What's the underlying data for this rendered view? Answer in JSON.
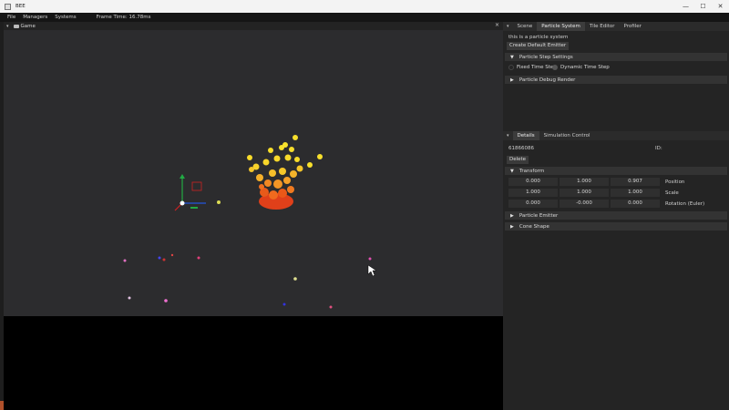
{
  "window": {
    "title": "BEE",
    "controls": [
      "—",
      "☐",
      "✕"
    ]
  },
  "menu": {
    "items": [
      "File",
      "Managers",
      "Systems"
    ],
    "frame_time": "Frame Time: 16.78ms"
  },
  "game_panel": {
    "tab_label": "Game",
    "close": "×"
  },
  "top_panel": {
    "tabs": [
      "Scene",
      "Particle System",
      "Tile Editor",
      "Profiler"
    ],
    "active_tab": "Particle System",
    "description": "this is a particle system",
    "create_button": "Create Default Emitter",
    "step_section": "Particle Step Settings",
    "fixed_label": "Fixed Time Step",
    "dynamic_label": "Dynamic Time Step",
    "debug_section": "Particle Debug Render"
  },
  "bottom_panel": {
    "tabs": [
      "Details",
      "Simulation Control"
    ],
    "entity_id": "61866086",
    "id_label": "ID:",
    "delete_button": "Delete",
    "transform_section": "Transform",
    "rows": [
      {
        "values": [
          "0.000",
          "1.000",
          "0.907"
        ],
        "label": "Position"
      },
      {
        "values": [
          "1.000",
          "1.000",
          "1.000"
        ],
        "label": "Scale"
      },
      {
        "values": [
          "0.000",
          "-0.000",
          "0.000"
        ],
        "label": "Rotation (Euler)"
      }
    ],
    "emitter_section": "Particle Emitter",
    "cone_section": "Cone Shape"
  },
  "colors": {
    "viewport": "#2c2c2e",
    "panel": "#242424",
    "flame_yellow": "#f5d020",
    "flame_orange": "#f07820",
    "gizmo_x": "#2255dd",
    "gizmo_y": "#22aa44",
    "gizmo_z": "#cc2222"
  }
}
